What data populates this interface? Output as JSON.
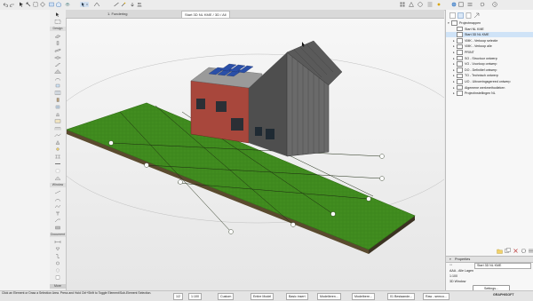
{
  "tabs": [
    {
      "label": "1. Fundering",
      "active": false
    },
    {
      "label": "Start 3D NL KME / 3D / All",
      "active": true
    }
  ],
  "toolbox": {
    "sections": [
      "Design",
      "Window",
      "Document"
    ],
    "more_label": "More"
  },
  "navigator": {
    "items": [
      {
        "label": "Projectmappen",
        "level": 0,
        "arrow": "▾",
        "selected": false
      },
      {
        "label": "Start NL KME",
        "level": 1,
        "arrow": "",
        "selected": false
      },
      {
        "label": "Start 3D NL KME",
        "level": 1,
        "arrow": "",
        "selected": true
      },
      {
        "label": "VMK - Verkoop selectie",
        "level": 1,
        "arrow": "▸",
        "selected": false
      },
      {
        "label": "VMK - Verkoop alle",
        "level": 1,
        "arrow": "▸",
        "selected": false
      },
      {
        "label": "PRINT",
        "level": 1,
        "arrow": "▸",
        "selected": false
      },
      {
        "label": "SO - Structuur ontwerp",
        "level": 1,
        "arrow": "▸",
        "selected": false
      },
      {
        "label": "VO - Voorloop ontwerp",
        "level": 1,
        "arrow": "▸",
        "selected": false
      },
      {
        "label": "DO - Definitief ontwerp",
        "level": 1,
        "arrow": "▸",
        "selected": false
      },
      {
        "label": "TO - Technisch ontwerp",
        "level": 1,
        "arrow": "▸",
        "selected": false
      },
      {
        "label": "UO - Uitvoeringsgereed ontwerp",
        "level": 1,
        "arrow": "▸",
        "selected": false
      },
      {
        "label": "Algemene werkmethodieken",
        "level": 1,
        "arrow": "▸",
        "selected": false
      },
      {
        "label": "Projectinstellingen NL",
        "level": 1,
        "arrow": "▸",
        "selected": false
      }
    ]
  },
  "properties": {
    "header": "Properties",
    "name_value": "Start 3D NL KME",
    "layer_value": "AAA - Alle Lagen",
    "scale_value": "1:100",
    "window_value": "3D Window",
    "settings_label": "Settings..."
  },
  "brand": "GRAPHISOFT",
  "status": {
    "hint": "Click an Element or Draw a Selection Area. Press and Hold Ctrl+Shift to Toggle Element/Sub-Element Selection.",
    "scale": "1:100",
    "custom": "Custom",
    "model": "Entire Model",
    "layer": "Basic insert",
    "combo1": "Modelleren...",
    "combo2": "Modelbere...",
    "combo3": "01 Bestaande...",
    "combo4": "Raw - semco...",
    "zoom": "1/2"
  },
  "colors": {
    "grass": "#3f8a1e",
    "grass_dark": "#2f6a14",
    "brick": "#a8473c",
    "roof": "#5a5a5a",
    "panel": "#2a4fa8",
    "selection": "#cfe3f7"
  }
}
